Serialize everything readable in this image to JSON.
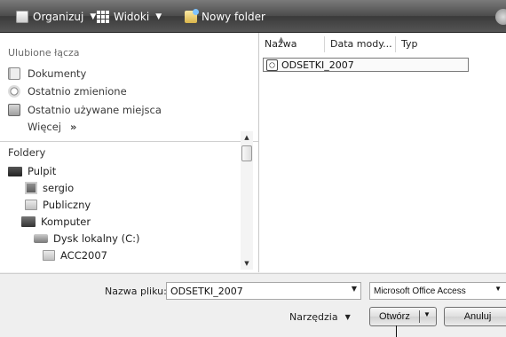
{
  "toolbar": {
    "organize_label": "Organizuj",
    "views_label": "Widoki",
    "new_folder_label": "Nowy folder"
  },
  "favorites": {
    "title": "Ulubione łącza",
    "items": [
      {
        "label": "Dokumenty",
        "icon": "documents-icon"
      },
      {
        "label": "Ostatnio zmienione",
        "icon": "recently-changed-icon"
      },
      {
        "label": "Ostatnio używane miejsca",
        "icon": "recent-places-icon"
      }
    ],
    "more_label": "Więcej",
    "more_arrow": "»"
  },
  "folders": {
    "title": "Foldery",
    "chevron": "⌄",
    "tree": [
      {
        "label": "Pulpit",
        "icon": "desktop-icon"
      },
      {
        "label": "sergio",
        "icon": "user-folder-icon"
      },
      {
        "label": "Publiczny",
        "icon": "folder-icon"
      },
      {
        "label": "Komputer",
        "icon": "computer-icon"
      },
      {
        "label": "Dysk lokalny (C:)",
        "icon": "drive-icon"
      },
      {
        "label": "ACC2007",
        "icon": "folder-icon"
      }
    ]
  },
  "file_list": {
    "columns": [
      "Nazwa",
      "Data mody...",
      "Typ"
    ],
    "files": [
      {
        "name": "ODSETKI_2007",
        "icon": "access-file-icon"
      }
    ]
  },
  "bottom": {
    "filename_label": "Nazwa pliku:",
    "filename_value": "ODSETKI_2007",
    "filetype_value": "Microsoft Office Access",
    "tools_label": "Narzędzia",
    "open_label": "Otwórz",
    "cancel_label": "Anuluj"
  }
}
